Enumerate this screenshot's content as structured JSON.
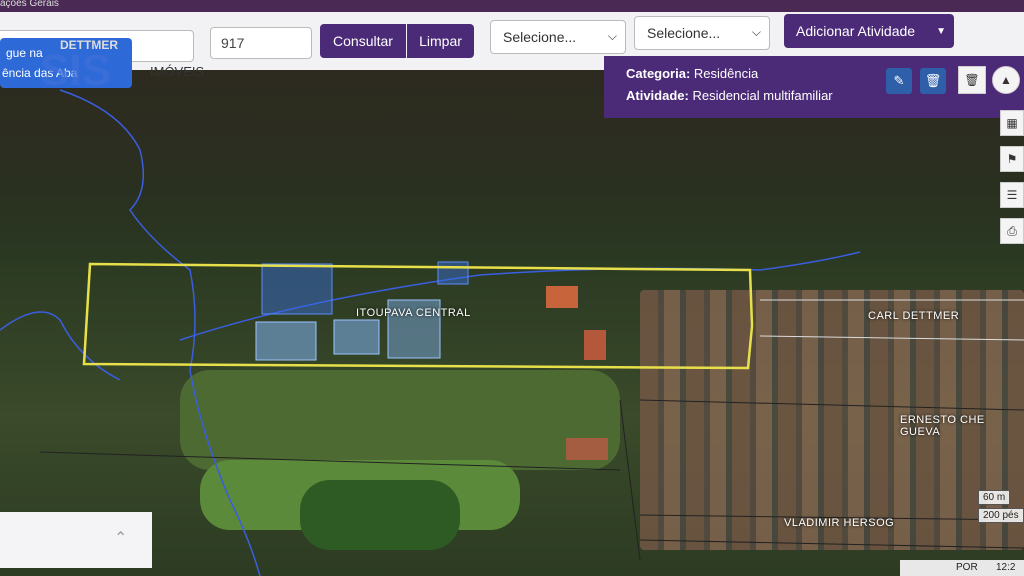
{
  "header": {
    "partial_title": "ações Gerais"
  },
  "toolbar": {
    "code_value": "917",
    "consult_label": "Consultar",
    "clear_label": "Limpar",
    "select1_value": "Selecione...",
    "select2_value": "Selecione...",
    "add_activity_label": "Adicionar Atividade"
  },
  "logo": {
    "line1": "gue na",
    "line2": "ência das Aba",
    "brand": "SIS",
    "brand_sub": "IMÓVEIS",
    "watermark": "DETTMER"
  },
  "popup": {
    "category_label": "Categoria:",
    "category_value": "Residência",
    "activity_label": "Atividade:",
    "activity_value": "Residencial multifamiliar"
  },
  "map": {
    "label_area": "ITOUPAVA CENTRAL",
    "street_1": "CARL DETTMER",
    "street_2": "ERNESTO CHE GUEVA",
    "street_3": "VLADIMIR HERSOG",
    "scale_1": "60 m",
    "scale_2": "200 pés"
  },
  "taskbar": {
    "lang": "POR",
    "time": "12:2"
  },
  "colors": {
    "accent": "#4b2a78",
    "highlight_yellow": "#e8e04a",
    "water_blue": "#3a6ee0"
  },
  "icons": [
    "chevron-down-icon",
    "trash-icon",
    "compass-icon",
    "qr-icon",
    "bookmark-icon",
    "layers-icon",
    "print-icon",
    "chevron-up-icon"
  ]
}
